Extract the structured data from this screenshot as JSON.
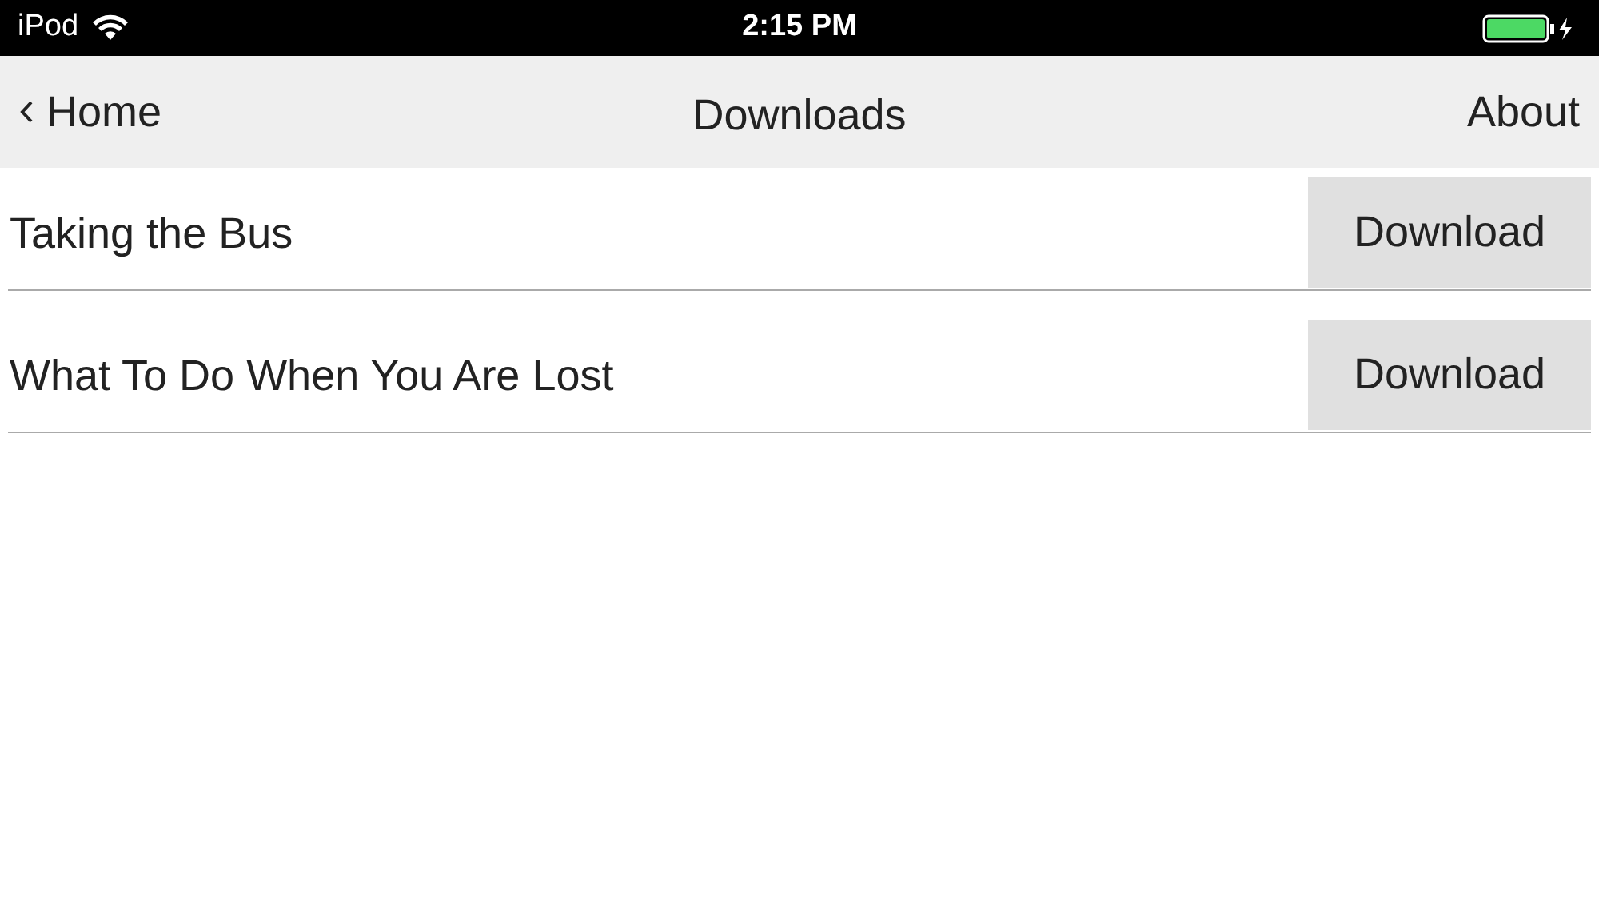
{
  "status_bar": {
    "carrier": "iPod",
    "time": "2:15 PM"
  },
  "nav_bar": {
    "back": "Home",
    "title": "Downloads",
    "action": "About"
  },
  "items": [
    {
      "title": "Taking the Bus",
      "button": "Download"
    },
    {
      "title": "What To Do When You Are Lost",
      "button": "Download"
    }
  ]
}
